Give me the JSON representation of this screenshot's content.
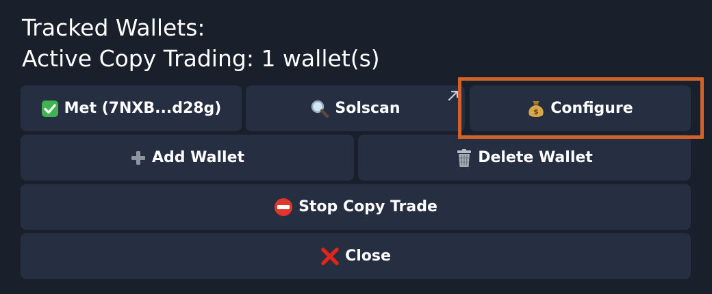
{
  "message": {
    "line1": "Tracked Wallets:",
    "line2": "Active Copy Trading: 1 wallet(s)"
  },
  "buttons": {
    "wallet": {
      "label": "Met (7NXB...d28g)",
      "icon": "check-mark-icon"
    },
    "solscan": {
      "label": "Solscan",
      "icon": "magnifier-icon",
      "link_indicator": "external-arrow-icon"
    },
    "configure": {
      "label": "Configure",
      "icon": "money-bag-icon"
    },
    "add_wallet": {
      "label": "Add Wallet",
      "icon": "plus-icon"
    },
    "delete_wallet": {
      "label": "Delete Wallet",
      "icon": "trash-icon"
    },
    "stop_copy_trade": {
      "label": "Stop Copy Trade",
      "icon": "no-entry-icon"
    },
    "close": {
      "label": "Close",
      "icon": "cross-icon"
    }
  },
  "colors": {
    "background": "#19202b",
    "button": "#252f41",
    "highlight": "#d0622a"
  }
}
